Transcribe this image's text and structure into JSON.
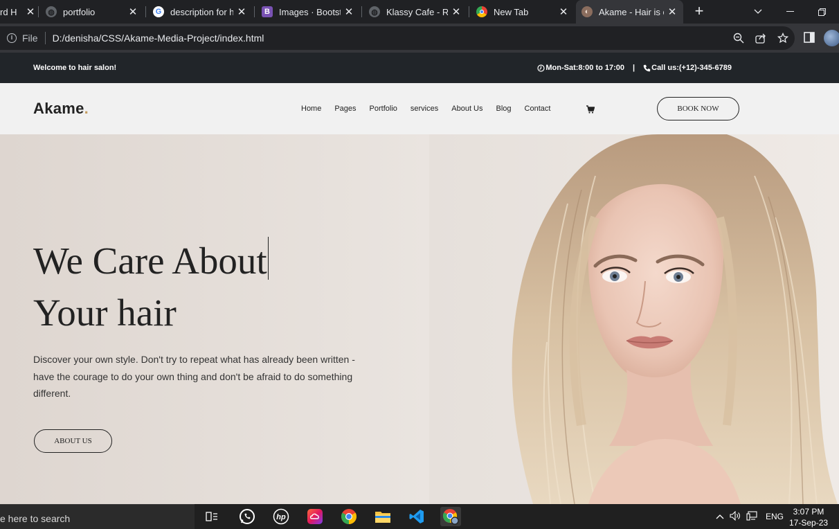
{
  "browser": {
    "tabs": [
      {
        "title": "rd H",
        "favicon": "globe-icon",
        "active": false
      },
      {
        "title": "portfolio",
        "favicon": "globe-icon",
        "active": false
      },
      {
        "title": "description for ha",
        "favicon": "google-icon",
        "active": false
      },
      {
        "title": "Images · Bootstra",
        "favicon": "bootstrap-icon",
        "active": false
      },
      {
        "title": "Klassy Cafe - Rest",
        "favicon": "globe-icon",
        "active": false
      },
      {
        "title": "New Tab",
        "favicon": "chrome-icon",
        "active": false
      },
      {
        "title": "Akame - Hair is o",
        "favicon": "hair-icon",
        "active": true
      }
    ],
    "address": {
      "scheme_label": "File",
      "url": "D:/denisha/CSS/Akame-Media-Project/index.html"
    }
  },
  "site": {
    "topbar": {
      "welcome": "Welcome to hair salon!",
      "hours": "Mon-Sat:8:00 to 17:00",
      "separator": "|",
      "phone": "Call us:(+12)-345-6789"
    },
    "brand": {
      "name": "Akame",
      "dot": "."
    },
    "nav": [
      "Home",
      "Pages",
      "Portfolio",
      "services",
      "About Us",
      "Blog",
      "Contact"
    ],
    "book_button": "BOOK NOW",
    "hero": {
      "title_line1": "We Care About",
      "title_line2": "Your hair",
      "description": "Discover your own style. Don't try to repeat what has already been written - have the courage to do your own thing and don't be afraid to do something different.",
      "button": "ABOUT US"
    },
    "colors": {
      "accent": "#c59d5f",
      "topbar": "#212529",
      "navbar": "#f1f1f1"
    }
  },
  "taskbar": {
    "search_placeholder": "e here to search",
    "tray_language": "ENG",
    "time": "3:07 PM",
    "date": "17-Sep-23"
  }
}
